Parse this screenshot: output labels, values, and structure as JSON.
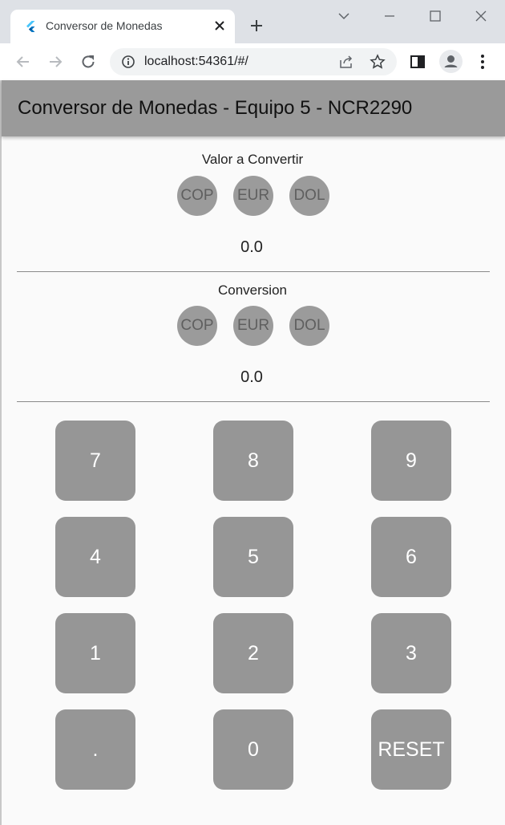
{
  "browser": {
    "tab_title": "Conversor de Monedas",
    "url": "localhost:54361/#/"
  },
  "app": {
    "title": "Conversor de Monedas - Equipo 5 - NCR2290",
    "input_section": {
      "label": "Valor a Convertir",
      "currencies": [
        "COP",
        "EUR",
        "DOL"
      ],
      "value": "0.0"
    },
    "output_section": {
      "label": "Conversion",
      "currencies": [
        "COP",
        "EUR",
        "DOL"
      ],
      "value": "0.0"
    },
    "keypad": [
      "7",
      "8",
      "9",
      "4",
      "5",
      "6",
      "1",
      "2",
      "3",
      ".",
      "0",
      "RESET"
    ]
  },
  "colors": {
    "appbar": "#9a9a9a",
    "coin": "#9b9b9b",
    "key": "#969696"
  }
}
